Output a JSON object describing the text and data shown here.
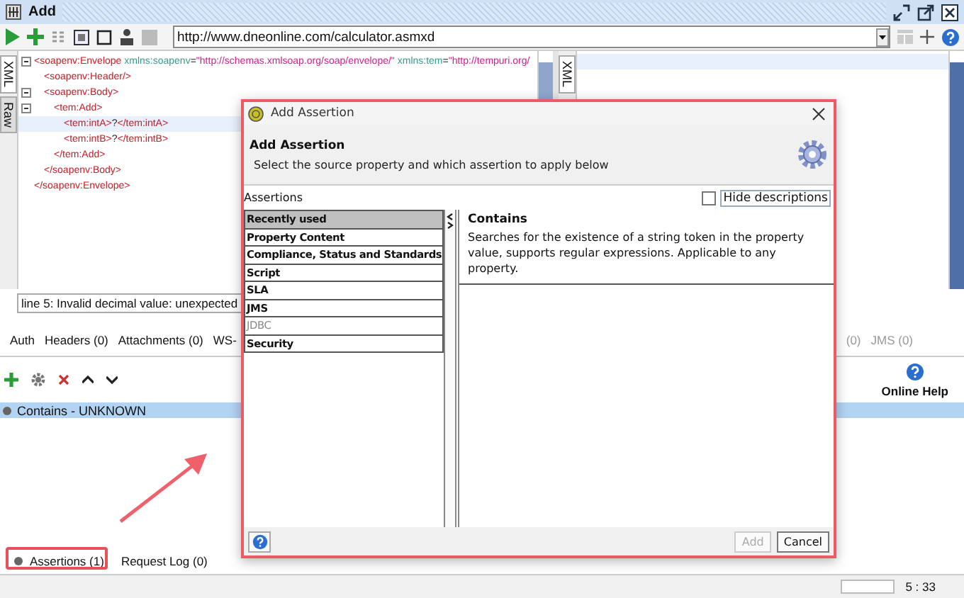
{
  "window": {
    "title": "Add"
  },
  "toolbar": {
    "url": "http://www.dneonline.com/calculator.asmxd"
  },
  "editor": {
    "tabs": [
      {
        "label": "XML",
        "selected": true
      },
      {
        "label": "Raw",
        "selected": false
      }
    ],
    "xml": [
      {
        "highlighted": false,
        "parts": [
          {
            "kind": "tag",
            "text": "<soapenv:Envelope"
          },
          {
            "kind": "attr",
            "text": " xmlns:soapenv"
          },
          {
            "kind": "eq",
            "text": "="
          },
          {
            "kind": "value",
            "text": "\"http://schemas.xmlsoap.org/soap/envelope/\""
          },
          {
            "kind": "attr",
            "text": " xmlns:tem"
          },
          {
            "kind": "eq",
            "text": "="
          },
          {
            "kind": "value",
            "text": "\"http://tempuri.org/"
          }
        ],
        "close": [
          {
            "kind": "tag",
            "text": "</soapenv:Envelope>"
          }
        ],
        "children": [
          {
            "highlighted": false,
            "parts": [
              {
                "kind": "tag",
                "text": "<soapenv:Header/>"
              }
            ]
          },
          {
            "highlighted": false,
            "parts": [
              {
                "kind": "tag",
                "text": "<soapenv:Body>"
              }
            ],
            "close": [
              {
                "kind": "tag",
                "text": "</soapenv:Body>"
              }
            ],
            "children": [
              {
                "highlighted": false,
                "parts": [
                  {
                    "kind": "tag",
                    "text": "<tem:Add>"
                  }
                ],
                "close": [
                  {
                    "kind": "tag",
                    "text": "</tem:Add>"
                  }
                ],
                "children": [
                  {
                    "highlighted": true,
                    "parts": [
                      {
                        "kind": "tag",
                        "text": "<tem:intA>"
                      },
                      {
                        "kind": "text",
                        "text": "?"
                      },
                      {
                        "kind": "tag",
                        "text": "</tem:intA>"
                      }
                    ]
                  },
                  {
                    "highlighted": false,
                    "parts": [
                      {
                        "kind": "tag",
                        "text": "<tem:intB>"
                      },
                      {
                        "kind": "text",
                        "text": "?"
                      },
                      {
                        "kind": "tag",
                        "text": "</tem:intB>"
                      }
                    ]
                  }
                ]
              }
            ]
          }
        ]
      }
    ],
    "right_tabs": [
      {
        "label": "XML",
        "selected": true
      }
    ],
    "message": "line 5: Invalid decimal value: unexpected"
  },
  "tabs": [
    {
      "label": "Auth",
      "disabled": false
    },
    {
      "label": "Headers (0)",
      "disabled": false
    },
    {
      "label": "Attachments (0)",
      "disabled": false
    },
    {
      "label": "WS-",
      "disabled": false
    },
    {
      "label": "(0)",
      "disabled": true
    },
    {
      "label": "JMS (0)",
      "disabled": true
    }
  ],
  "help_button": "Online Help",
  "assertions": [
    {
      "label": "Contains - UNKNOWN",
      "selected": true
    }
  ],
  "bottom_tabs": [
    {
      "label": "Assertions (1)",
      "selected": true
    },
    {
      "label": "Request Log (0)",
      "selected": false
    }
  ],
  "status_bar": {
    "position": "5 : 33"
  },
  "dialog": {
    "title": "Add Assertion",
    "heading": "Add Assertion",
    "subtitle": "Select the source property and which assertion to apply below",
    "list_label": "Assertions",
    "hide_descriptions": {
      "label": "Hide descriptions",
      "checked": false
    },
    "categories": [
      {
        "label": "Recently used",
        "selected": true,
        "disabled": false
      },
      {
        "label": "Property Content",
        "selected": false,
        "disabled": false
      },
      {
        "label": "Compliance, Status and Standards",
        "selected": false,
        "disabled": false
      },
      {
        "label": "Script",
        "selected": false,
        "disabled": false
      },
      {
        "label": "SLA",
        "selected": false,
        "disabled": false
      },
      {
        "label": "JMS",
        "selected": false,
        "disabled": false
      },
      {
        "label": "JDBC",
        "selected": false,
        "disabled": true
      },
      {
        "label": "Security",
        "selected": false,
        "disabled": false
      }
    ],
    "assertion": {
      "name": "Contains",
      "description": "Searches for the existence of a string token in the property value, supports regular expressions. Applicable to any property."
    },
    "buttons": [
      {
        "label": "Add",
        "disabled": true
      },
      {
        "label": "Cancel",
        "disabled": false
      }
    ]
  }
}
